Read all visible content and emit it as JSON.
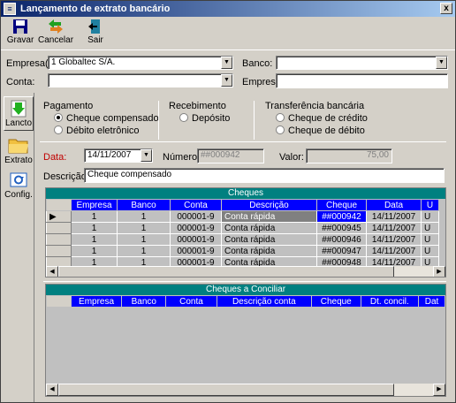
{
  "window": {
    "title": "Lançamento de extrato bancário",
    "close": "x"
  },
  "toolbar": {
    "gravar": "Gravar",
    "cancelar": "Cancelar",
    "sair": "Sair"
  },
  "form": {
    "empresa_label": "Empresa(s):",
    "empresa_value": "1  Globaltec S/A.",
    "conta_label": "Conta:",
    "banco_label": "Banco:",
    "empresa2_label": "Empresa:"
  },
  "side": {
    "lancto": "Lancto",
    "extrato": "Extrato",
    "config": "Config."
  },
  "groups": {
    "pagamento": "Pagamento",
    "recebimento": "Recebimento",
    "transferencia": "Transferência bancária",
    "cheque_comp": "Cheque compensado",
    "debito_eletr": "Débito eletrônico",
    "deposito": "Depósito",
    "cheque_credito": "Cheque de crédito",
    "cheque_debito": "Cheque de débito"
  },
  "fields": {
    "data_label": "Data:",
    "data_value": "14/11/2007",
    "numero_label": "Número:",
    "numero_value": "##000942",
    "valor_label": "Valor:",
    "valor_value": "75,00",
    "descricao_label": "Descrição:",
    "descricao_value": "Cheque compensado"
  },
  "cheques": {
    "title": "Cheques",
    "headers": [
      "Empresa",
      "Banco",
      "Conta",
      "Descrição",
      "Cheque",
      "Data",
      "U"
    ],
    "rows": [
      [
        "1",
        "1",
        "000001-9",
        "Conta rápida",
        "##000942",
        "14/11/2007",
        "U"
      ],
      [
        "1",
        "1",
        "000001-9",
        "Conta rápida",
        "##000945",
        "14/11/2007",
        "U"
      ],
      [
        "1",
        "1",
        "000001-9",
        "Conta rápida",
        "##000946",
        "14/11/2007",
        "U"
      ],
      [
        "1",
        "1",
        "000001-9",
        "Conta rápida",
        "##000947",
        "14/11/2007",
        "U"
      ],
      [
        "1",
        "1",
        "000001-9",
        "Conta rápida",
        "##000948",
        "14/11/2007",
        "U"
      ]
    ]
  },
  "conciliar": {
    "title": "Cheques a Conciliar",
    "headers": [
      "Empresa",
      "Banco",
      "Conta",
      "Descrição conta",
      "Cheque",
      "Dt. concil.",
      "Dat"
    ]
  },
  "icons": {
    "arrow_down": "▼",
    "arrow_left": "◀",
    "arrow_right": "▶",
    "row_pointer": "▶"
  }
}
